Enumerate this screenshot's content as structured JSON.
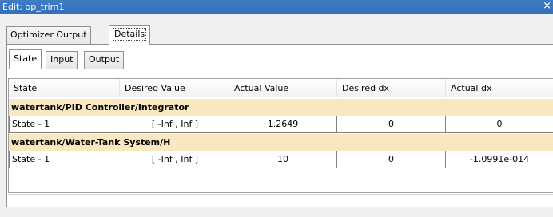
{
  "window": {
    "title": "Edit: op_trim1",
    "close_glyph": "×"
  },
  "outer_tabs": [
    {
      "label": "Optimizer Output",
      "active": false
    },
    {
      "label": "Details",
      "active": true
    }
  ],
  "inner_tabs": [
    {
      "label": "State",
      "active": true
    },
    {
      "label": "Input",
      "active": false
    },
    {
      "label": "Output",
      "active": false
    }
  ],
  "table": {
    "columns": [
      "State",
      "Desired Value",
      "Actual Value",
      "Desired dx",
      "Actual dx"
    ],
    "groups": [
      {
        "name": "watertank/PID Controller/Integrator",
        "rows": [
          {
            "state": "State - 1",
            "desired_value": "[ -Inf , Inf ]",
            "actual_value": "1.2649",
            "desired_dx": "0",
            "actual_dx": "0"
          }
        ]
      },
      {
        "name": "watertank/Water-Tank System/H",
        "rows": [
          {
            "state": "State - 1",
            "desired_value": "[ -Inf , Inf ]",
            "actual_value": "10",
            "desired_dx": "0",
            "actual_dx": "-1.0991e-014"
          }
        ]
      }
    ]
  },
  "colors": {
    "titlebar": "#3a76c0",
    "group_row": "#f9e7c0",
    "panel": "#ffffff",
    "window_bg": "#f0f0f0"
  }
}
